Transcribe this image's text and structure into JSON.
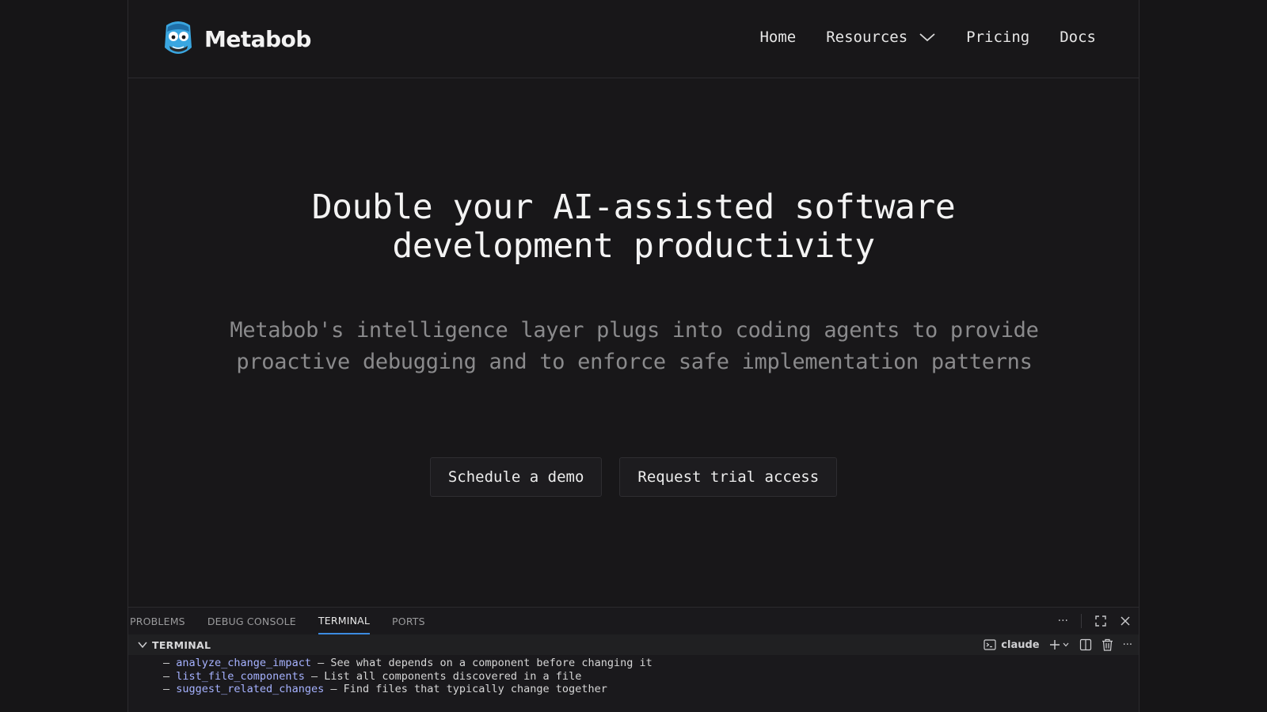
{
  "brand": {
    "name": "Metabob"
  },
  "nav": {
    "items": [
      {
        "label": "Home"
      },
      {
        "label": "Resources",
        "has_dropdown": true
      },
      {
        "label": "Pricing"
      },
      {
        "label": "Docs"
      }
    ]
  },
  "hero": {
    "title_line1": "Double your AI-assisted software",
    "title_line2": "development productivity",
    "subtitle": "Metabob's intelligence layer plugs into coding agents to provide proactive debugging and to enforce safe implementation patterns"
  },
  "cta": {
    "demo_label": "Schedule a demo",
    "trial_label": "Request trial access"
  },
  "panel": {
    "tabs": [
      {
        "label": "PROBLEMS",
        "active": false
      },
      {
        "label": "DEBUG CONSOLE",
        "active": false
      },
      {
        "label": "TERMINAL",
        "active": true
      },
      {
        "label": "PORTS",
        "active": false
      }
    ],
    "more_label": "···",
    "terminal_header": "TERMINAL",
    "terminal_tab": "claude",
    "terminal_more_label": "···",
    "lines": [
      {
        "bullet": "– ",
        "tool": "analyze_change_impact",
        "desc": " – See what depends on a component before changing it"
      },
      {
        "bullet": "– ",
        "tool": "list_file_components",
        "desc": " – List all components discovered in a file"
      },
      {
        "bullet": "– ",
        "tool": "suggest_related_changes",
        "desc": " – Find files that typically change together"
      }
    ]
  },
  "colors": {
    "background": "#161517",
    "accent_tab": "#3c8be0",
    "tool_name": "#a6b2ff",
    "subtitle": "#8a8a8c"
  },
  "icons": {
    "logo": "metabob-logo-icon",
    "dropdown": "chevron-down-icon",
    "maximize": "maximize-icon",
    "close": "close-icon",
    "terminal": "terminal-icon",
    "add": "plus-icon",
    "split": "split-icon",
    "trash": "trash-icon"
  }
}
